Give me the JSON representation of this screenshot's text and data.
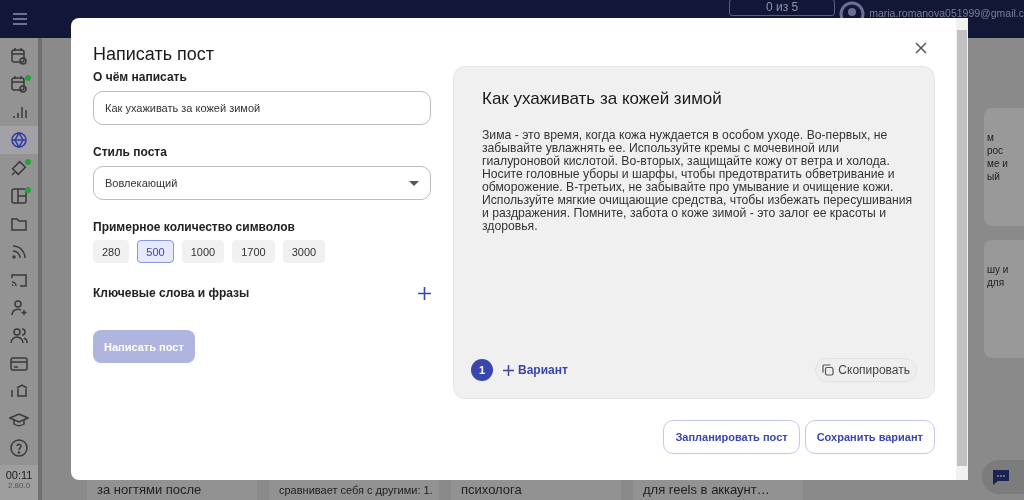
{
  "top_bar": {
    "counter": "0 из 5",
    "email": "maria.romanova051999@gmail.c"
  },
  "sidebar": {
    "items": [
      {
        "selected": false,
        "notification": false
      },
      {
        "selected": false,
        "notification": true
      },
      {
        "selected": false,
        "notification": false
      },
      {
        "selected": true,
        "notification": false
      },
      {
        "selected": false,
        "notification": true
      },
      {
        "selected": false,
        "notification": true
      },
      {
        "selected": false,
        "notification": false
      },
      {
        "selected": false,
        "notification": false
      },
      {
        "selected": false,
        "notification": false
      },
      {
        "selected": false,
        "notification": false
      },
      {
        "selected": false,
        "notification": false
      },
      {
        "selected": false,
        "notification": false
      },
      {
        "selected": false,
        "notification": false
      },
      {
        "selected": false,
        "notification": false
      },
      {
        "selected": false,
        "notification": false
      }
    ],
    "time": "00:11",
    "version": "2.80.0"
  },
  "background_cards": {
    "right": [
      {
        "lines": [
          "м",
          "рос",
          "ме и",
          "ый"
        ]
      },
      {
        "lines": [
          "шу и",
          "для"
        ]
      }
    ],
    "bottom": [
      {
        "text": "за ногтями после"
      },
      {
        "text": "сравнивает себя с другими: 1."
      },
      {
        "text": "психолога"
      },
      {
        "text": "для reels в аккаунт…"
      }
    ]
  },
  "modal": {
    "title": "Написать пост",
    "topic": {
      "label": "О чём написать",
      "value": "Как ухаживать за кожей зимой"
    },
    "style": {
      "label": "Стиль поста",
      "value": "Вовлекающий"
    },
    "length": {
      "label": "Примерное количество символов",
      "options": [
        {
          "label": "280",
          "selected": false
        },
        {
          "label": "500",
          "selected": true
        },
        {
          "label": "1000",
          "selected": false
        },
        {
          "label": "1700",
          "selected": false
        },
        {
          "label": "3000",
          "selected": false
        }
      ]
    },
    "keywords": {
      "label": "Ключевые слова и фразы"
    },
    "submit": {
      "label": "Написать пост",
      "disabled": true
    },
    "preview": {
      "title": "Как ухаживать за кожей зимой",
      "body": "Зима - это время, когда кожа нуждается в особом уходе. Во-первых, не забывайте увлажнять ее. Используйте кремы с мочевиной или гиалуроновой кислотой. Во-вторых, защищайте кожу от ветра и холода. Носите головные уборы и шарфы, чтобы предотвратить обветривание и обморожение. В-третьих, не забывайте про умывание и очищение кожи. Используйте мягкие очищающие средства, чтобы избежать пересушивания и раздражения. Помните, забота о коже зимой - это залог ее красоты и здоровья.",
      "variant_number": "1",
      "add_variant": "Вариант",
      "copy": "Скопировать"
    },
    "actions": [
      "Запланировать пост",
      "Сохранить вариант"
    ]
  }
}
